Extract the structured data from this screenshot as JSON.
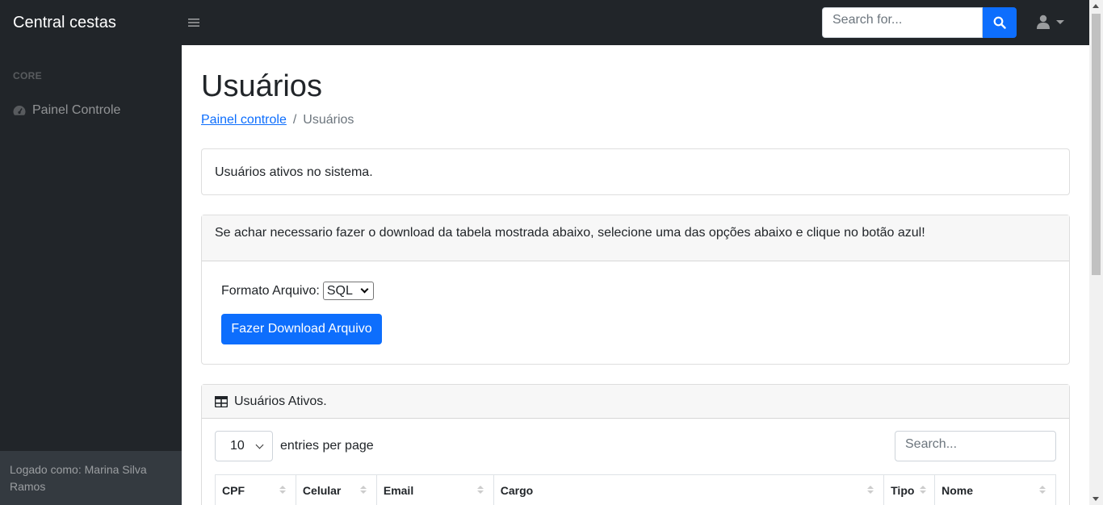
{
  "topnav": {
    "brand": "Central cestas",
    "search_placeholder": "Search for...",
    "toggle_icon": "hamburger-icon",
    "search_icon": "search-icon",
    "user_icon": "user-icon"
  },
  "sidebar": {
    "heading": "CORE",
    "items": [
      {
        "label": "Painel Controle",
        "icon": "dashboard-gauge-icon"
      }
    ],
    "footer": "Logado como: Marina Silva Ramos"
  },
  "main": {
    "title": "Usuários",
    "breadcrumb": [
      {
        "label": "Painel controle",
        "link": true
      },
      {
        "label": "Usuários",
        "link": false
      }
    ],
    "info_text": "Usuários ativos no sistema.",
    "download_card": {
      "header": "Se achar necessario fazer o download da tabela mostrada abaixo, selecione uma das opções abaixo e clique no botão azul!",
      "format_label": "Formato Arquivo:",
      "format_value": "SQL",
      "button_label": "Fazer Download Arquivo"
    },
    "table_card": {
      "header": "Usuários Ativos.",
      "header_icon": "table-icon",
      "per_page_value": "10",
      "per_page_label": "entries per page",
      "search_placeholder": "Search...",
      "columns": [
        "CPF",
        "Celular",
        "Email",
        "Cargo",
        "Tipo",
        "Nome"
      ]
    }
  },
  "colors": {
    "dark": "#212529",
    "primary": "#0d6efd",
    "footer_bg": "#343a40"
  }
}
